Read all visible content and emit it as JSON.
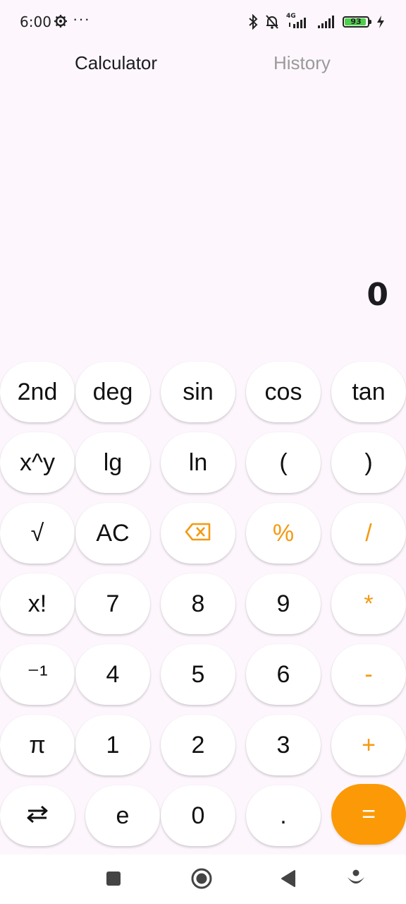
{
  "status_bar": {
    "time": "6:00",
    "battery_level": "93",
    "battery_fraction": 0.93,
    "icons": [
      "settings-gear-icon",
      "more-dots-icon",
      "bluetooth-icon",
      "silent-bell-icon",
      "signal-4g-icon",
      "signal-bars-icon",
      "battery-icon",
      "charging-bolt-icon"
    ],
    "more_dots": "···",
    "network_label": "4G",
    "battery_color": "#4CD04A"
  },
  "tabs": {
    "calculator": "Calculator",
    "history": "History",
    "active": "calculator"
  },
  "display": {
    "value": "0"
  },
  "keypad": {
    "accent_color": "#F39A12",
    "equals_bg": "#FB9A06",
    "rows": [
      [
        "2nd",
        "deg",
        "sin",
        "cos",
        "tan"
      ],
      [
        "x^y",
        "lg",
        "ln",
        "(",
        ")"
      ],
      [
        "√",
        "AC",
        "backspace",
        "%",
        "/"
      ],
      [
        "x!",
        "7",
        "8",
        "9",
        "*"
      ],
      [
        "⁻¹",
        "4",
        "5",
        "6",
        "-"
      ],
      [
        "π",
        "1",
        "2",
        "3",
        "+"
      ],
      [
        "swap",
        "e",
        "0",
        ".",
        "="
      ]
    ],
    "labels": {
      "k2nd": "2nd",
      "deg": "deg",
      "sin": "sin",
      "cos": "cos",
      "tan": "tan",
      "xpowy": "x^y",
      "lg": "lg",
      "ln": "ln",
      "lparen": "(",
      "rparen": ")",
      "sqrt": "√",
      "ac": "AC",
      "percent": "%",
      "divide": "/",
      "fact": "x!",
      "seven": "7",
      "eight": "8",
      "nine": "9",
      "multiply": "*",
      "inverse": "⁻¹",
      "four": "4",
      "five": "5",
      "six": "6",
      "minus": "-",
      "pi": "π",
      "one": "1",
      "two": "2",
      "three": "3",
      "plus": "+",
      "e": "e",
      "zero": "0",
      "dot": ".",
      "equals": "="
    }
  },
  "nav_bar": {
    "buttons": [
      "recents-square-icon",
      "home-circle-icon",
      "back-triangle-icon",
      "assistant-icon"
    ]
  }
}
